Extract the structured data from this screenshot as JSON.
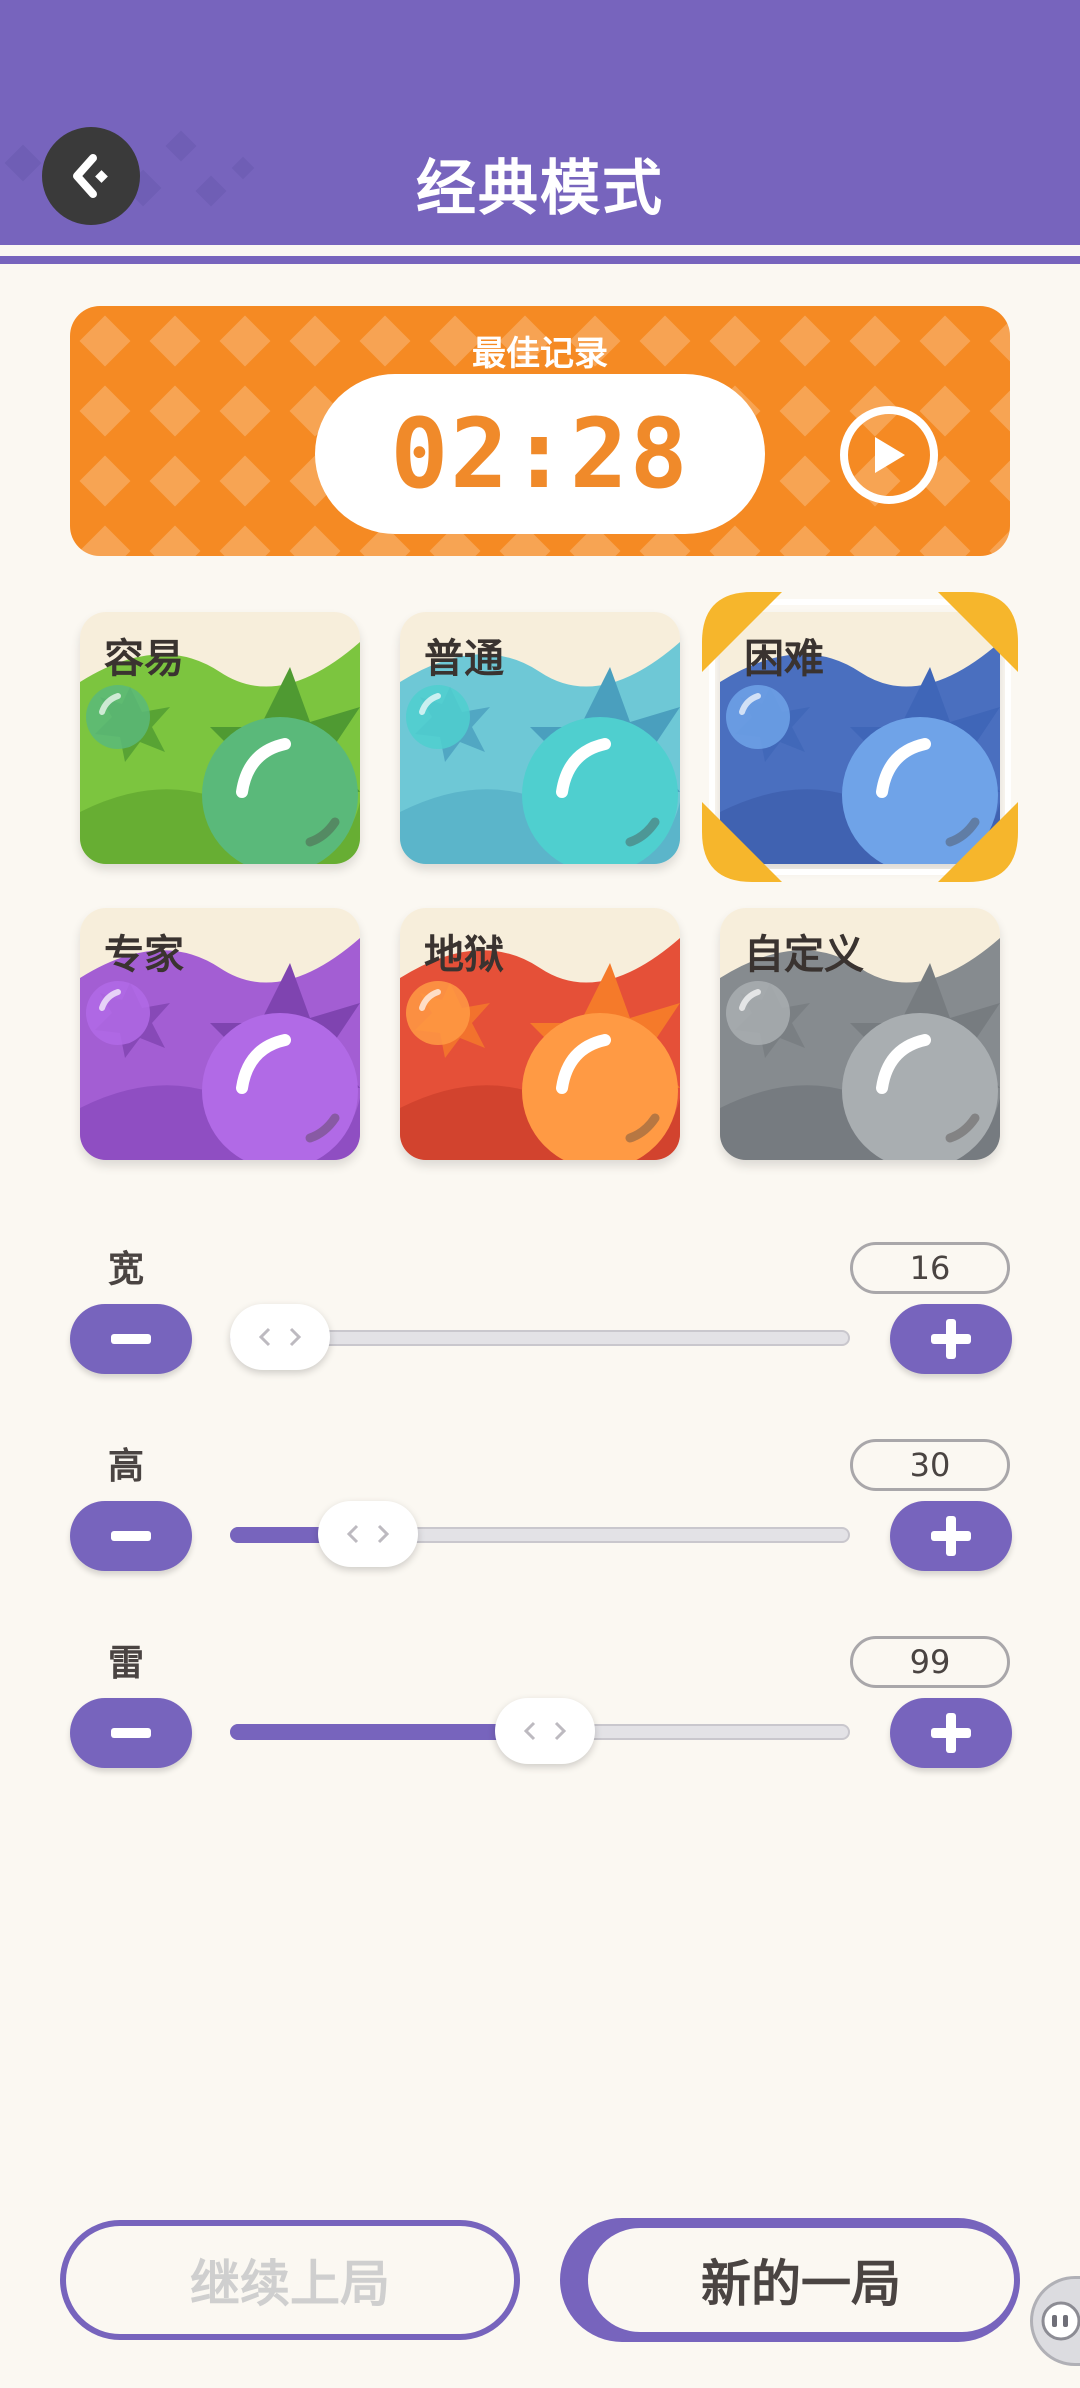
{
  "header": {
    "title": "经典模式"
  },
  "best": {
    "label": "最佳记录",
    "time": "02:28"
  },
  "difficulties": [
    {
      "label": "容易",
      "selected": false
    },
    {
      "label": "普通",
      "selected": false
    },
    {
      "label": "困难",
      "selected": true
    },
    {
      "label": "专家",
      "selected": false
    },
    {
      "label": "地狱",
      "selected": false
    },
    {
      "label": "自定义",
      "selected": false
    }
  ],
  "sliders": [
    {
      "label": "宽",
      "value": "16",
      "fraction": 0.0
    },
    {
      "label": "高",
      "value": "30",
      "fraction": 0.17
    },
    {
      "label": "雷",
      "value": "99",
      "fraction": 0.51
    }
  ],
  "buttons": {
    "continue": "继续上局",
    "new_game": "新的一局"
  },
  "colors": {
    "primary": "#7764bd",
    "best_card": "#f58a23",
    "easy": "#7cc53f",
    "normal": "#6ec8d6",
    "hard": "#4a6fbf",
    "expert": "#a35ed3",
    "hell": "#e55038",
    "custom": "#868b8f",
    "selected_frame": "#f6b62c"
  }
}
